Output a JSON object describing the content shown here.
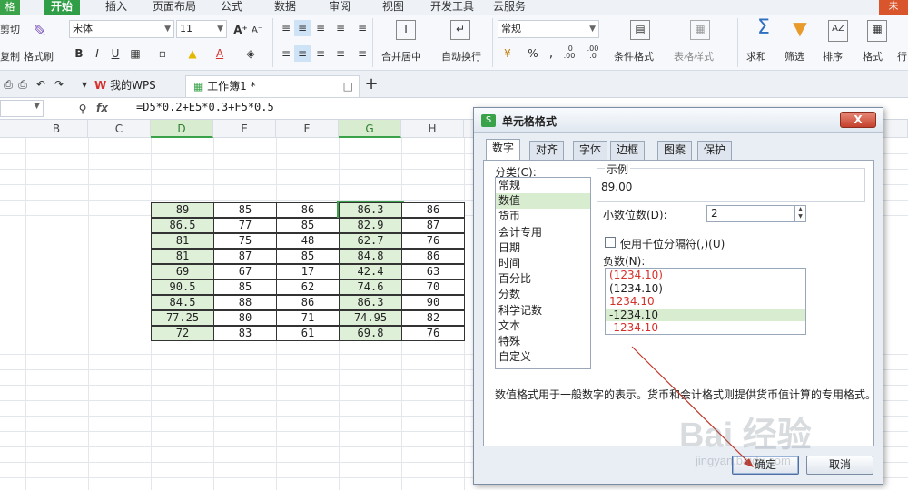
{
  "ribbon_tabs": {
    "logo": "格",
    "items": [
      "开始",
      "插入",
      "页面布局",
      "公式",
      "数据",
      "审阅",
      "视图",
      "开发工具",
      "云服务"
    ],
    "account": "未"
  },
  "ribbon": {
    "cut": "剪切",
    "copy": "复制",
    "format_painter": "格式刷",
    "font_name": "宋体",
    "font_size": "11",
    "bold": "B",
    "italic": "I",
    "underline": "U",
    "merge_center": "合并居中",
    "wrap_text": "自动换行",
    "number_format": "常规",
    "percent": "%",
    "thousands": ",",
    "dec_inc": ".0 .00",
    "dec_dec": ".00 .0",
    "conditional_format": "条件格式",
    "table_style": "表格样式",
    "sum": "求和",
    "filter": "筛选",
    "sort": "排序",
    "format": "格式",
    "row_col": "行"
  },
  "doc_tabs": {
    "wps_tab": "我的WPS",
    "workbook_tab": "工作簿1 *",
    "add": "+"
  },
  "formula_bar": {
    "fx": "fx",
    "formula": "=D5*0.2+E5*0.3+F5*0.5"
  },
  "grid": {
    "columns": [
      "B",
      "C",
      "D",
      "E",
      "F",
      "G",
      "H"
    ],
    "rows": [
      [
        "89",
        "85",
        "86",
        "86.3",
        "86"
      ],
      [
        "86.5",
        "77",
        "85",
        "82.9",
        "87"
      ],
      [
        "81",
        "75",
        "48",
        "62.7",
        "76"
      ],
      [
        "81",
        "87",
        "85",
        "84.8",
        "86"
      ],
      [
        "69",
        "67",
        "17",
        "42.4",
        "63"
      ],
      [
        "90.5",
        "85",
        "62",
        "74.6",
        "70"
      ],
      [
        "84.5",
        "88",
        "86",
        "86.3",
        "90"
      ],
      [
        "77.25",
        "80",
        "71",
        "74.95",
        "82"
      ],
      [
        "72",
        "83",
        "61",
        "69.8",
        "76"
      ]
    ]
  },
  "dialog": {
    "title": "单元格格式",
    "close": "X",
    "tabs": [
      "数字",
      "对齐",
      "字体",
      "边框",
      "图案",
      "保护"
    ],
    "category_label": "分类(C):",
    "categories": [
      "常规",
      "数值",
      "货币",
      "会计专用",
      "日期",
      "时间",
      "百分比",
      "分数",
      "科学记数",
      "文本",
      "特殊",
      "自定义"
    ],
    "selected_category": "数值",
    "sample_label": "示例",
    "sample_value": "89.00",
    "decimals_label": "小数位数(D):",
    "decimals_value": "2",
    "thousands_label": "使用千位分隔符(,)(U)",
    "negative_label": "负数(N):",
    "negative_options": [
      "(1234.10)",
      "(1234.10)",
      "1234.10",
      "-1234.10",
      "-1234.10"
    ],
    "negative_colors": [
      "#d6302a",
      "#222222",
      "#d6302a",
      "#222222",
      "#d6302a"
    ],
    "description": "数值格式用于一般数字的表示。货币和会计格式则提供货币值计算的专用格式。",
    "ok": "确定",
    "cancel": "取消"
  },
  "watermark": {
    "text": "Bai 经验",
    "sub": "jingyan.baidu.com"
  },
  "colors": {
    "accent_green": "#3aa34a",
    "highlight_green": "#dff0d8",
    "negative_red": "#d6302a"
  }
}
